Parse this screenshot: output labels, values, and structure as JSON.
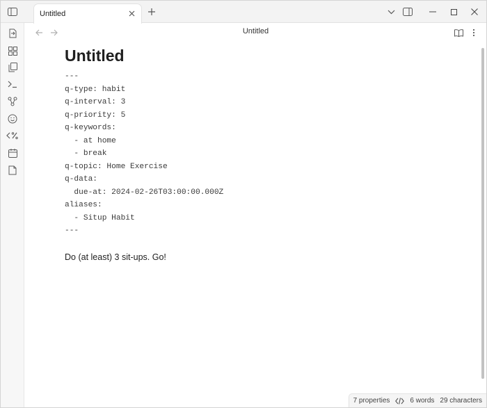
{
  "tab": {
    "title": "Untitled"
  },
  "view": {
    "title": "Untitled"
  },
  "document": {
    "title": "Untitled",
    "frontmatter": [
      "---",
      "q-type: habit",
      "q-interval: 3",
      "q-priority: 5",
      "q-keywords:",
      "  - at home",
      "  - break",
      "q-topic: Home Exercise",
      "q-data:",
      "  due-at: 2024-02-26T03:00:00.000Z",
      "aliases:",
      "  - Situp Habit",
      "---"
    ],
    "body": "Do (at least) 3 sit-ups. Go!"
  },
  "status": {
    "properties": "7 properties",
    "words": "6 words",
    "characters": "29 characters"
  },
  "icons": {
    "sidebar_toggle": "sidebar-toggle-icon",
    "ribbon": [
      "file-switch-icon",
      "grid-icon",
      "copy-icon",
      "terminal-icon",
      "graph-icon",
      "smiley-icon",
      "templater-icon",
      "calendar-icon",
      "file-icon"
    ]
  }
}
